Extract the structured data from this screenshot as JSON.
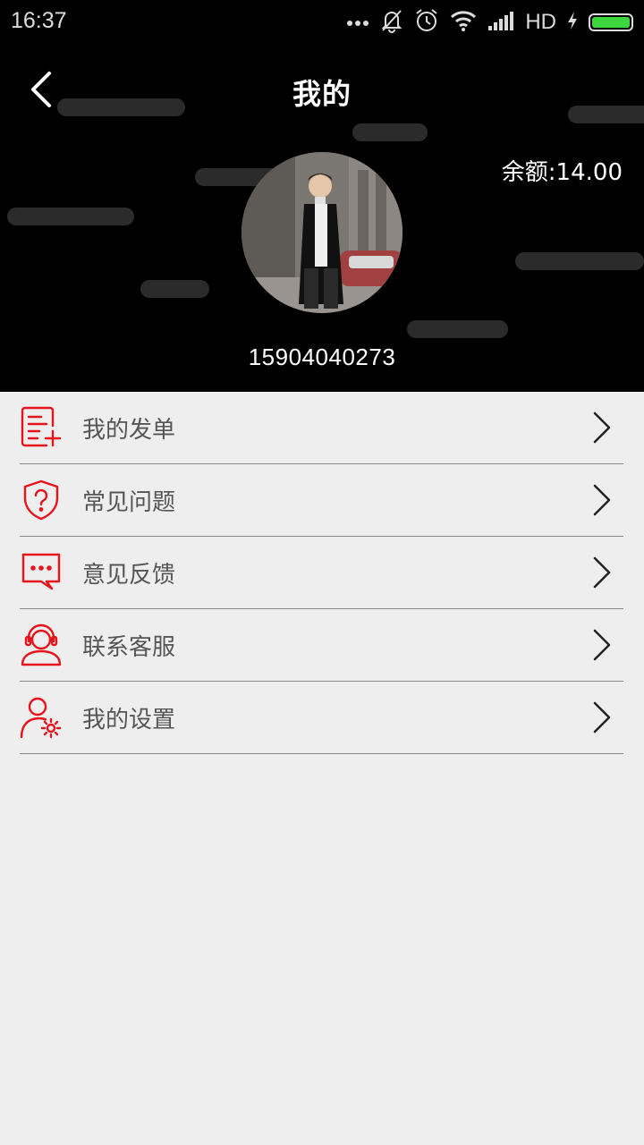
{
  "status_bar": {
    "time": "16:37",
    "network": "HD",
    "icons": [
      "more-dots-icon",
      "mute-bell-icon",
      "alarm-icon",
      "wifi-icon",
      "signal-icon",
      "charging-icon",
      "battery-icon"
    ],
    "battery_level": 1.0,
    "battery_color": "#3ed63e"
  },
  "header": {
    "title": "我的",
    "balance": "余额:14.00",
    "phone": "15904040273",
    "back_icon": "chevron-left-icon"
  },
  "menu": {
    "items": [
      {
        "label": "我的发单",
        "icon": "order-add-icon"
      },
      {
        "label": "常见问题",
        "icon": "question-shield-icon"
      },
      {
        "label": "意见反馈",
        "icon": "chat-feedback-icon"
      },
      {
        "label": "联系客服",
        "icon": "headset-agent-icon"
      },
      {
        "label": "我的设置",
        "icon": "user-settings-icon"
      }
    ],
    "icon_color": "#e8141c"
  }
}
